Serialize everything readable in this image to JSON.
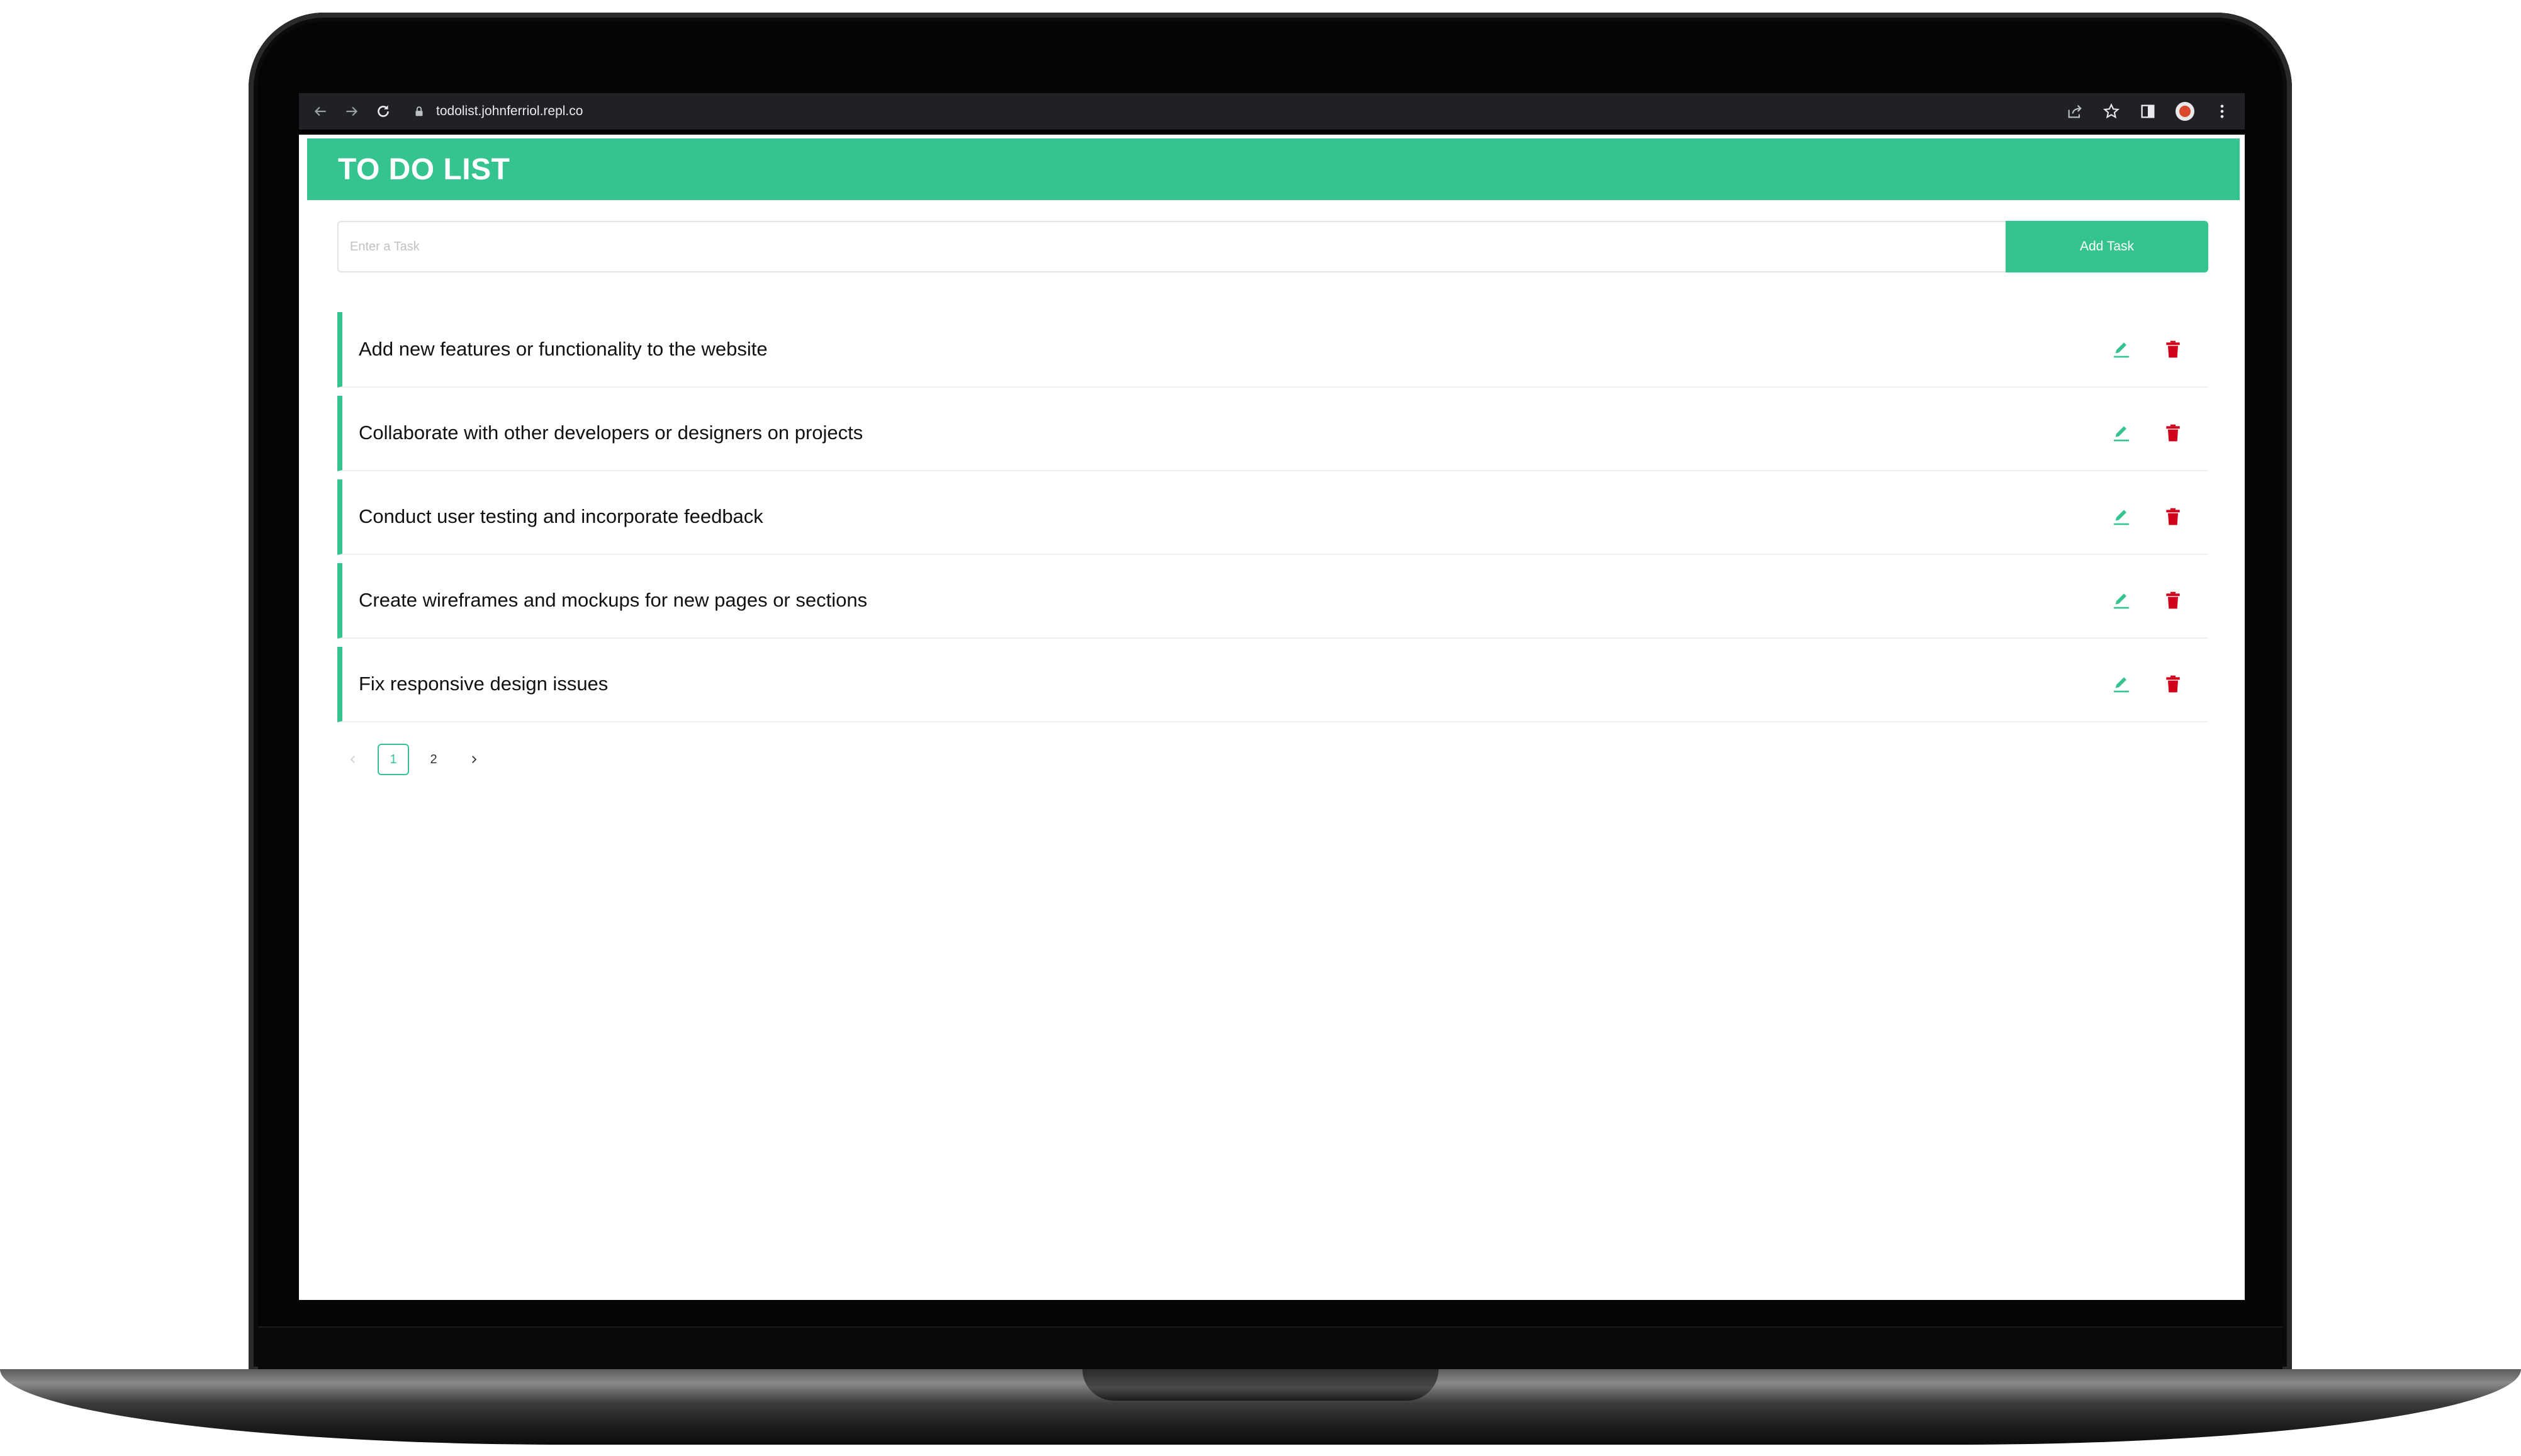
{
  "browser": {
    "url": "todolist.johnferriol.repl.co",
    "icons": [
      "back-icon",
      "forward-icon",
      "reload-icon",
      "lock-icon",
      "share-icon",
      "star-icon",
      "side-panel-icon",
      "profile-avatar",
      "menu-icon"
    ]
  },
  "app": {
    "title": "TO DO LIST",
    "accent_color": "#35c48f",
    "delete_color": "#d0021b"
  },
  "form": {
    "placeholder": "Enter a Task",
    "value": "",
    "button_label": "Add Task"
  },
  "tasks": [
    {
      "text": "Add new features or functionality to the website"
    },
    {
      "text": "Collaborate with other developers or designers on projects"
    },
    {
      "text": "Conduct user testing and incorporate feedback"
    },
    {
      "text": "Create wireframes and mockups for new pages or sections"
    },
    {
      "text": "Fix responsive design issues"
    }
  ],
  "pagination": {
    "pages": [
      "1",
      "2"
    ],
    "current": "1"
  }
}
